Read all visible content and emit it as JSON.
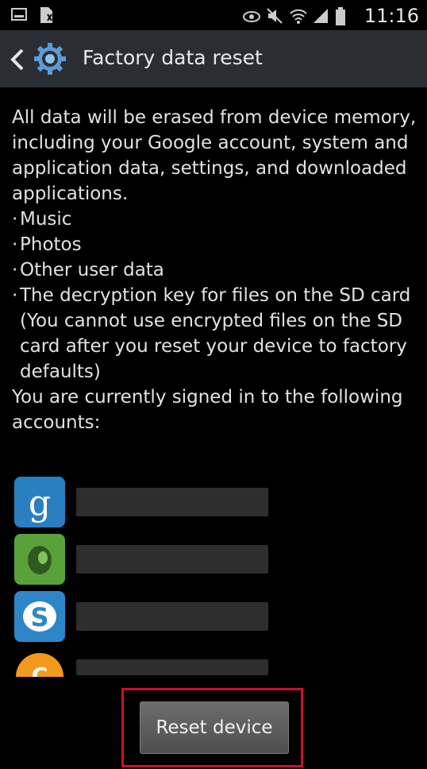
{
  "status_bar": {
    "time": "11:16",
    "icons": [
      "gallery-icon",
      "sim-icon",
      "eye-icon",
      "mute-icon",
      "wifi-icon",
      "signal-icon",
      "battery-icon"
    ]
  },
  "header": {
    "title": "Factory data reset",
    "icons": [
      "back-arrow-icon",
      "settings-gear-icon"
    ]
  },
  "content": {
    "intro": "All data will be erased from device memory, including your Google account, system and application data, settings, and downloaded applications.",
    "bullets": [
      "Music",
      "Photos",
      "Other user data",
      "The decryption key for files on the SD card"
    ],
    "note": "(You cannot use encrypted files on the SD card after you reset your device to factory defaults)",
    "accounts_heading": "You are currently signed in to the following accounts:"
  },
  "accounts": [
    {
      "icon": "google-account-icon",
      "color": "#2a7fc1"
    },
    {
      "icon": "evernote-account-icon",
      "color": "#5aa13b"
    },
    {
      "icon": "skype-account-icon",
      "color": "#2d86c8"
    },
    {
      "icon": "orange-c-account-icon",
      "color": "#f39a1a"
    }
  ],
  "reset_button": {
    "label": "Reset device",
    "highlight_color": "#c8102e"
  }
}
